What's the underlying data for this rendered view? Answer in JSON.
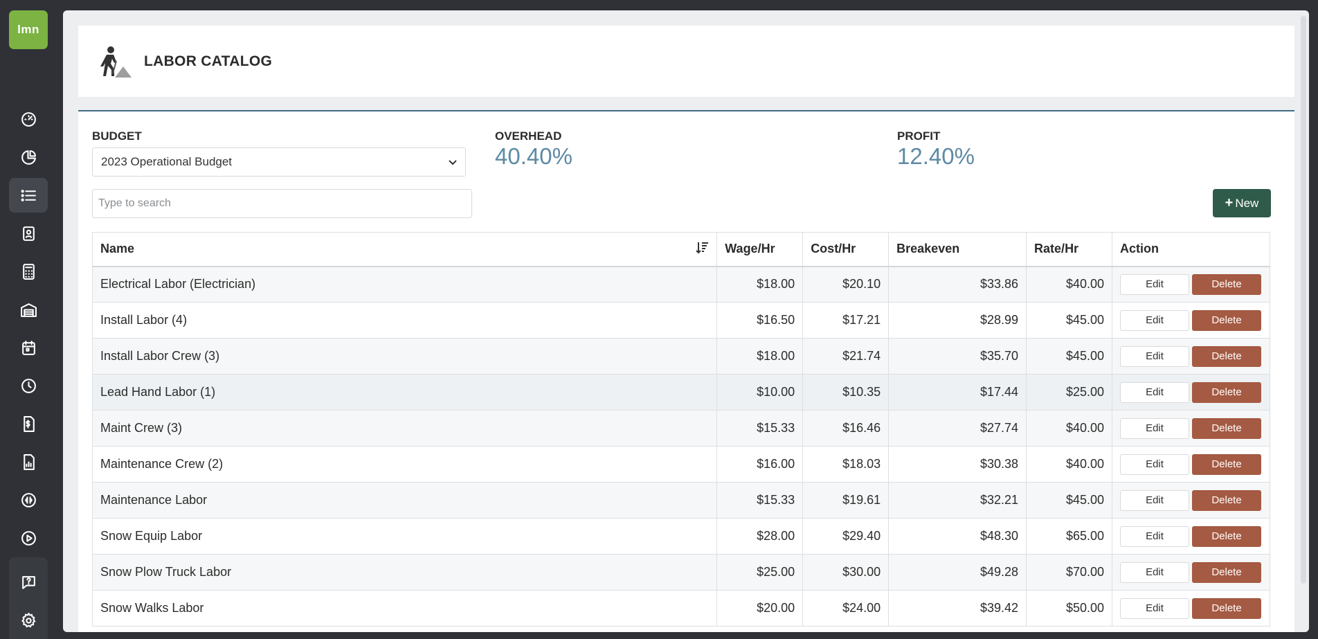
{
  "app": {
    "logo_text": "lmn"
  },
  "sidebar": {
    "items": [
      {
        "name": "dashboard-icon"
      },
      {
        "name": "pie-chart-icon"
      },
      {
        "name": "list-icon",
        "active": true
      },
      {
        "name": "contact-card-icon"
      },
      {
        "name": "calculator-icon"
      },
      {
        "name": "warehouse-icon"
      },
      {
        "name": "calendar-icon"
      },
      {
        "name": "clock-icon"
      },
      {
        "name": "invoice-icon"
      },
      {
        "name": "report-icon"
      },
      {
        "name": "quickbooks-icon"
      },
      {
        "name": "play-icon"
      },
      {
        "name": "help-icon"
      },
      {
        "name": "settings-icon"
      }
    ]
  },
  "header": {
    "title": "LABOR CATALOG"
  },
  "budget": {
    "label": "BUDGET",
    "selected": "2023 Operational Budget"
  },
  "overhead": {
    "label": "OVERHEAD",
    "value": "40.40%"
  },
  "profit": {
    "label": "PROFIT",
    "value": "12.40%"
  },
  "search": {
    "placeholder": "Type to search"
  },
  "new_button": {
    "label": "New"
  },
  "table": {
    "columns": [
      "Name",
      "Wage/Hr",
      "Cost/Hr",
      "Breakeven",
      "Rate/Hr",
      "Action"
    ],
    "edit_label": "Edit",
    "delete_label": "Delete",
    "rows": [
      {
        "name": "Electrical Labor (Electrician)",
        "wage": "$18.00",
        "cost": "$20.10",
        "breakeven": "$33.86",
        "rate": "$40.00"
      },
      {
        "name": "Install Labor (4)",
        "wage": "$16.50",
        "cost": "$17.21",
        "breakeven": "$28.99",
        "rate": "$45.00"
      },
      {
        "name": "Install Labor Crew (3)",
        "wage": "$18.00",
        "cost": "$21.74",
        "breakeven": "$35.70",
        "rate": "$45.00"
      },
      {
        "name": "Lead Hand Labor (1)",
        "wage": "$10.00",
        "cost": "$10.35",
        "breakeven": "$17.44",
        "rate": "$25.00"
      },
      {
        "name": "Maint Crew (3)",
        "wage": "$15.33",
        "cost": "$16.46",
        "breakeven": "$27.74",
        "rate": "$40.00"
      },
      {
        "name": "Maintenance Crew (2)",
        "wage": "$16.00",
        "cost": "$18.03",
        "breakeven": "$30.38",
        "rate": "$40.00"
      },
      {
        "name": "Maintenance Labor",
        "wage": "$15.33",
        "cost": "$19.61",
        "breakeven": "$32.21",
        "rate": "$45.00"
      },
      {
        "name": "Snow Equip Labor",
        "wage": "$28.00",
        "cost": "$29.40",
        "breakeven": "$48.30",
        "rate": "$65.00"
      },
      {
        "name": "Snow Plow Truck Labor",
        "wage": "$25.00",
        "cost": "$30.00",
        "breakeven": "$49.28",
        "rate": "$70.00"
      },
      {
        "name": "Snow Walks Labor",
        "wage": "$20.00",
        "cost": "$24.00",
        "breakeven": "$39.42",
        "rate": "$50.00"
      }
    ]
  },
  "colors": {
    "accent": "#5e8aa5",
    "new_button": "#2f5b4a",
    "delete_button": "#a55a43",
    "logo": "#7cb342"
  }
}
